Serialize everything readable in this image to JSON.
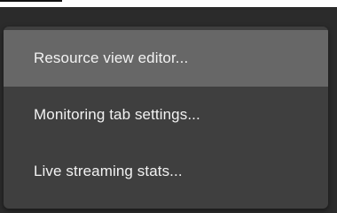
{
  "context_menu": {
    "items": [
      {
        "label": "Resource view editor...",
        "state": "highlighted"
      },
      {
        "label": "Monitoring tab settings...",
        "state": "normal"
      },
      {
        "label": "Live streaming stats...",
        "state": "normal"
      }
    ]
  },
  "colors": {
    "backdrop": "#2b2b2b",
    "menu_background": "#3f3f3f",
    "menu_highlight": "#676767",
    "menu_text": "#f2f2f2"
  }
}
